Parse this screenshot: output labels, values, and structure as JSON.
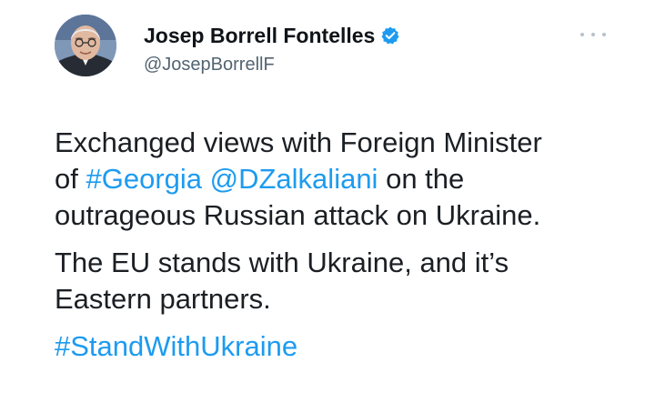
{
  "author": {
    "display_name": "Josep Borrell Fontelles",
    "handle": "@JosepBorrellF",
    "verified": true,
    "avatar_icon": "avatar-photo-icon"
  },
  "menu": {
    "more_icon": "more-options-icon"
  },
  "tweet": {
    "line1": "Exchanged views with Foreign Minister",
    "line2_prefix": "of",
    "hashtag_georgia": "#Georgia",
    "mention": "@DZalkaliani",
    "line2_suffix": "on the",
    "line3": "outrageous Russian attack on Ukraine.",
    "line4": "The EU stands with Ukraine, and it’s",
    "line5": "Eastern partners.",
    "hashtag_stand": "#StandWithUkraine"
  },
  "colors": {
    "link": "#1d9bf0",
    "text": "#0f1419",
    "secondary": "#536471",
    "verified_badge": "#1d9bf0"
  }
}
